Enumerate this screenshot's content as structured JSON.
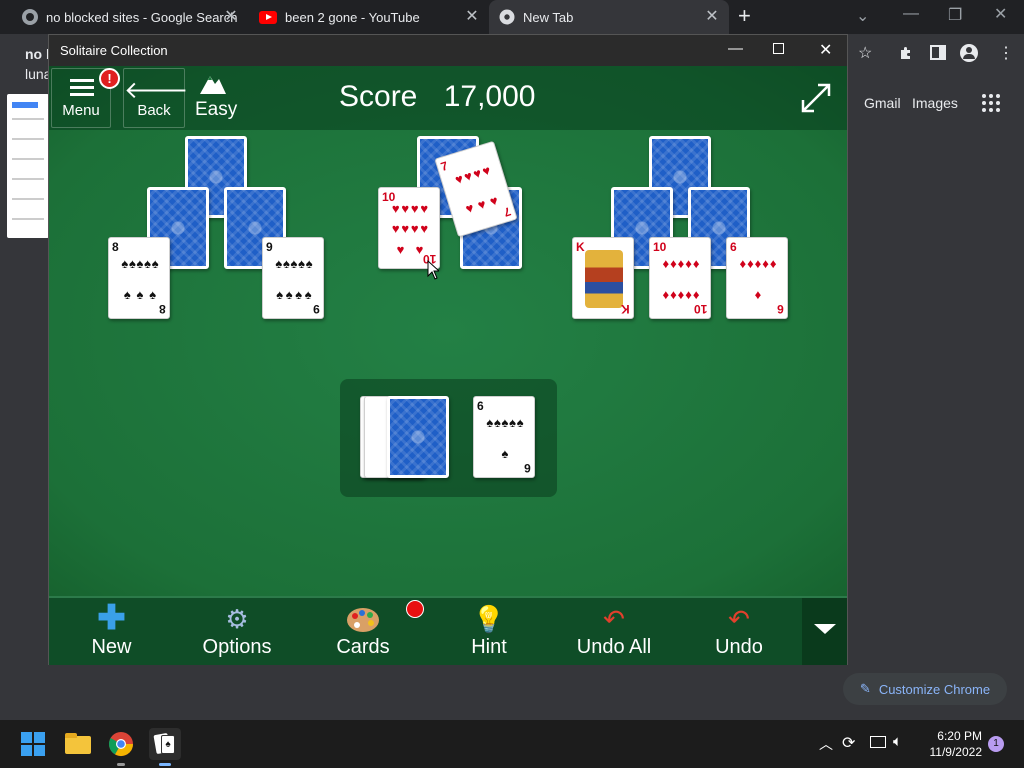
{
  "browser": {
    "tabs": [
      {
        "title": "no blocked sites - Google Search",
        "icon": "google-icon"
      },
      {
        "title": "been 2 gone - YouTube",
        "icon": "youtube-icon"
      },
      {
        "title": "New Tab",
        "icon": "chrome-icon"
      }
    ],
    "new_tab_symbol": "+",
    "partial_search_text": "no b",
    "partial_text_2": "luna",
    "ntp": {
      "gmail": "Gmail",
      "images": "Images",
      "customize": "Customize Chrome"
    }
  },
  "solitaire": {
    "window_title": "Solitaire Collection",
    "menu_label": "Menu",
    "menu_badge": "!",
    "back_label": "Back",
    "difficulty": "Easy",
    "score_label": "Score",
    "score_value": "17,000",
    "cards": {
      "left_1": {
        "rank": "8",
        "suit": "♠"
      },
      "left_2": {
        "rank": "9",
        "suit": "♠"
      },
      "mid_1": {
        "rank": "10",
        "suit": "♥"
      },
      "mid_dragged": {
        "rank": "7",
        "suit": "♥"
      },
      "right_1": {
        "rank": "K",
        "suit": "♦"
      },
      "right_2": {
        "rank": "10",
        "suit": "♦"
      },
      "right_3": {
        "rank": "6",
        "suit": "♦"
      },
      "waste": {
        "rank": "6",
        "suit": "♠"
      }
    },
    "commands": [
      {
        "label": "New",
        "icon": "plus-icon"
      },
      {
        "label": "Options",
        "icon": "gear-icon"
      },
      {
        "label": "Cards",
        "icon": "palette-icon"
      },
      {
        "label": "Hint",
        "icon": "lightbulb-icon"
      },
      {
        "label": "Undo All",
        "icon": "undo-all-icon"
      },
      {
        "label": "Undo",
        "icon": "undo-icon"
      }
    ]
  },
  "taskbar": {
    "time": "6:20 PM",
    "date": "11/9/2022",
    "notification_count": "1"
  },
  "colors": {
    "felt": "#1e7a3d",
    "command_bar": "#0f4d27",
    "card_back": "#1f5fc7",
    "badge_red": "#e02020"
  }
}
